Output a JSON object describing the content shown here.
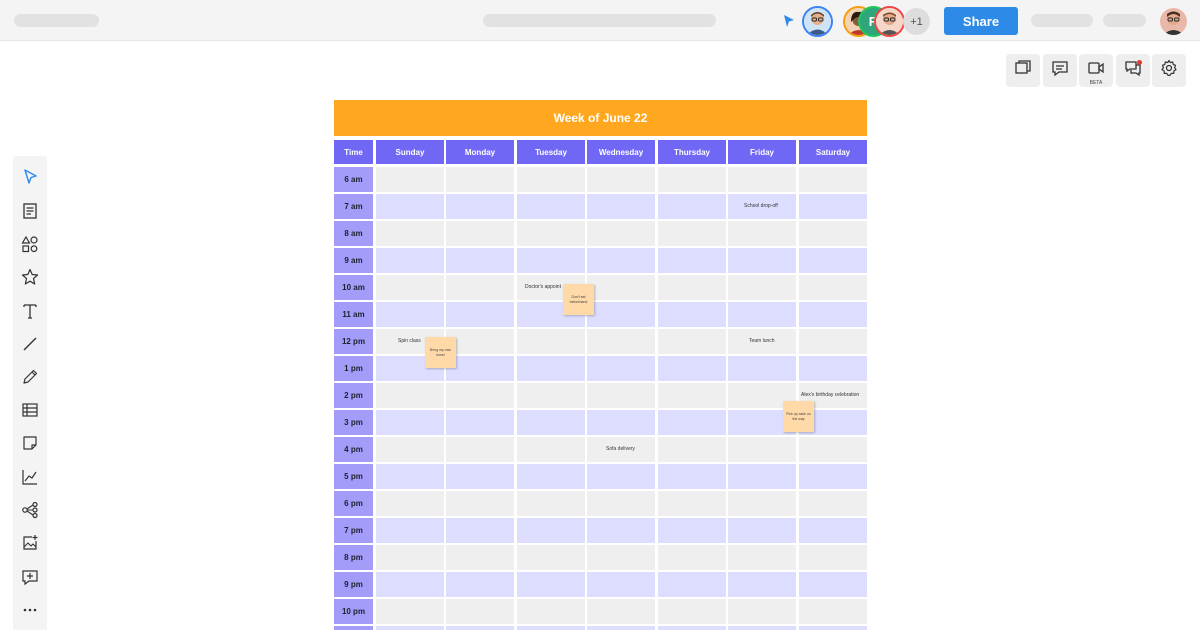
{
  "topbar": {
    "presence_more": "+1",
    "avatar_r_initial": "R",
    "share_label": "Share"
  },
  "right_tools": {
    "video_badge": "BETA"
  },
  "calendar": {
    "title": "Week of June 22",
    "time_header": "Time",
    "days": [
      "Sunday",
      "Monday",
      "Tuesday",
      "Wednesday",
      "Thursday",
      "Friday",
      "Saturday"
    ],
    "times": [
      "6 am",
      "7 am",
      "8 am",
      "9 am",
      "10 am",
      "11 am",
      "12 pm",
      "1 pm",
      "2 pm",
      "3 pm",
      "4 pm",
      "5 pm",
      "6 pm",
      "7 pm",
      "8 pm",
      "9 pm",
      "10 pm"
    ],
    "events": {
      "school_dropoff": "School drop-off",
      "doctors_appt": "Doctor's appoint",
      "spin_class": "Spin class",
      "team_lunch": "Team lunch",
      "birthday": "Alex's birthday celebration",
      "sofa_delivery": "Sofa delivery"
    },
    "stickies": {
      "settlement": "Don't eat beforehand",
      "towel": "Bring my own towel",
      "cake": "Pick up cake on the way"
    }
  },
  "colors": {
    "title_bar": "#ffa81f",
    "header": "#7167f5",
    "time_cell": "#a39cf8",
    "row_light": "#efefef",
    "row_lavender": "#dddeff",
    "share_button": "#2d8ae6",
    "sticky": "#ffd9a8"
  }
}
